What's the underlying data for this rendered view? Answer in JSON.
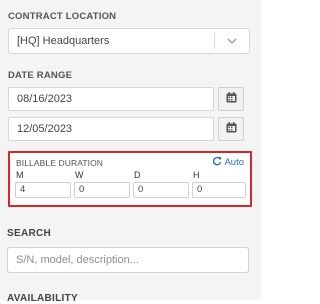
{
  "contract_location": {
    "label": "CONTRACT LOCATION",
    "value": "[HQ] Headquarters"
  },
  "date_range": {
    "label": "DATE RANGE",
    "start": "08/16/2023",
    "end": "12/05/2023"
  },
  "billable_duration": {
    "title": "BILLABLE DURATION",
    "auto_label": "Auto",
    "columns": [
      {
        "label": "M",
        "value": "4"
      },
      {
        "label": "W",
        "value": "0"
      },
      {
        "label": "D",
        "value": "0"
      },
      {
        "label": "H",
        "value": "0"
      }
    ],
    "highlight_color": "#d9262b"
  },
  "search": {
    "label": "SEARCH",
    "placeholder": "S/N, model, description..."
  },
  "availability": {
    "label": "AVAILABILITY"
  },
  "colors": {
    "panel_bg": "#f4f4f4",
    "link_blue": "#2f6fb7",
    "border_red": "#d9262b"
  },
  "icons": {
    "dropdown": "chevron-down-icon",
    "calendar": "calendar-icon",
    "refresh": "refresh-icon"
  }
}
